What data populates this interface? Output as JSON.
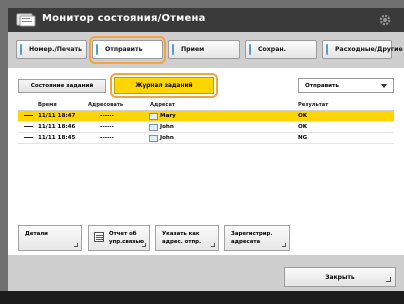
{
  "window": {
    "title": "Монитор состояния/Отмена"
  },
  "tabs": [
    {
      "label": "Номер./Печать"
    },
    {
      "label": "Отправить"
    },
    {
      "label": "Прием"
    },
    {
      "label": "Сохран."
    },
    {
      "label": "Расходные/Другие"
    }
  ],
  "subtabs": {
    "status": "Состояние заданий",
    "journal": "Журнал заданий"
  },
  "filter": {
    "selected": "Отправить"
  },
  "table": {
    "columns": [
      "Время",
      "Адресовать",
      "Адресат",
      "Результат"
    ],
    "rows": [
      {
        "time": "11/11 18:47",
        "dept": "------",
        "dest": "Mary",
        "result": "OK"
      },
      {
        "time": "11/11 18:46",
        "dept": "------",
        "dest": "John",
        "result": "OK"
      },
      {
        "time": "11/11 18:45",
        "dept": "------",
        "dest": "John",
        "result": "NG"
      }
    ]
  },
  "buttons": {
    "details": "Детали",
    "cancel_line1": "Отчет об",
    "cancel_line2": "упр.связью",
    "dest_line1": "Указать как",
    "dest_line2": "адрес. отпр.",
    "reg_line1": "Зарегистрир.",
    "reg_line2": "адресата",
    "close": "Закрыть"
  },
  "colors": {
    "accent": "#ffd500",
    "highlight": "#f3a53c",
    "titlebar": "#3a3a3a"
  }
}
